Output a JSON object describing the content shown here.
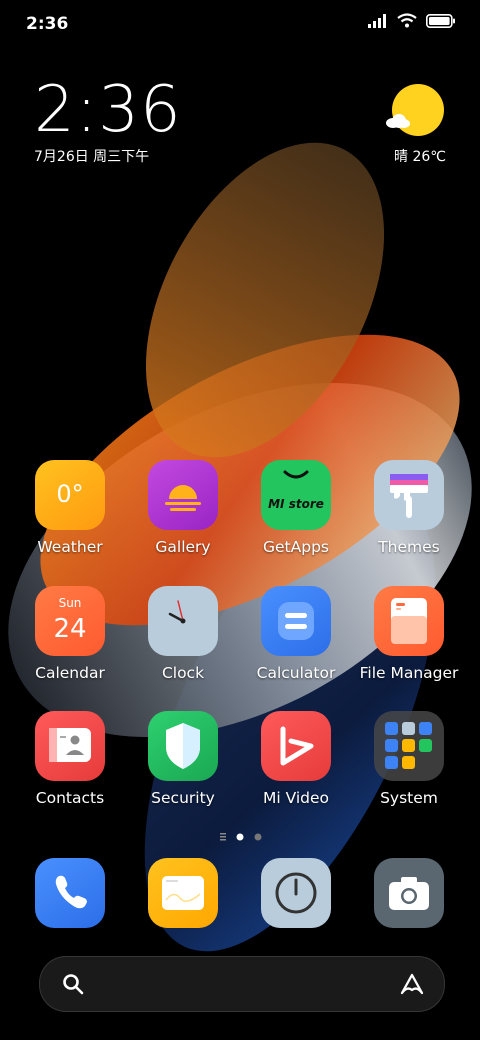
{
  "status_bar": {
    "time": "2:36"
  },
  "clock_widget": {
    "time": "2:36",
    "date": "7月26日 周三下午"
  },
  "weather_widget": {
    "text": "晴 26℃"
  },
  "apps": [
    {
      "name": "weather-app",
      "label": "Weather",
      "icon": "weather-icon",
      "text": "0°"
    },
    {
      "name": "gallery-app",
      "label": "Gallery",
      "icon": "gallery-icon"
    },
    {
      "name": "getapps-app",
      "label": "GetApps",
      "icon": "mi-store-icon",
      "text": "MI store"
    },
    {
      "name": "themes-app",
      "label": "Themes",
      "icon": "themes-icon"
    },
    {
      "name": "calendar-app",
      "label": "Calendar",
      "icon": "calendar-icon",
      "day": "Sun",
      "date": "24"
    },
    {
      "name": "clock-app",
      "label": "Clock",
      "icon": "clock-icon"
    },
    {
      "name": "calculator-app",
      "label": "Calculator",
      "icon": "calculator-icon"
    },
    {
      "name": "file-manager-app",
      "label": "File Manager",
      "icon": "folder-icon"
    },
    {
      "name": "contacts-app",
      "label": "Contacts",
      "icon": "contacts-icon"
    },
    {
      "name": "security-app",
      "label": "Security",
      "icon": "shield-icon"
    },
    {
      "name": "mi-video-app",
      "label": "Mi Video",
      "icon": "play-icon"
    },
    {
      "name": "system-folder",
      "label": "System",
      "icon": "folder-grid-icon"
    }
  ],
  "dock": [
    {
      "name": "phone-app",
      "icon": "phone-icon"
    },
    {
      "name": "messages-app",
      "icon": "message-icon"
    },
    {
      "name": "compass-app",
      "icon": "compass-icon"
    },
    {
      "name": "camera-app",
      "icon": "camera-icon"
    }
  ],
  "page_indicator": {
    "pages": 2,
    "current": 1
  },
  "colors": {
    "weather": "#ffb21a",
    "gallery": "#b534d6",
    "getapps": "#22c55e",
    "themes": "#b9ccdc",
    "calendar": "#ff6a3d",
    "clock": "#b9ccdc",
    "calculator": "#3d83f5",
    "file_manager": "#ff6a3d",
    "contacts": "#f04b4b",
    "security": "#22c55e",
    "mi_video": "#f04b4b",
    "system": "#3a3a3a",
    "phone": "#3d83f5",
    "messages": "#ffb800",
    "compass": "#b9ccdc",
    "camera": "#5a6670"
  }
}
